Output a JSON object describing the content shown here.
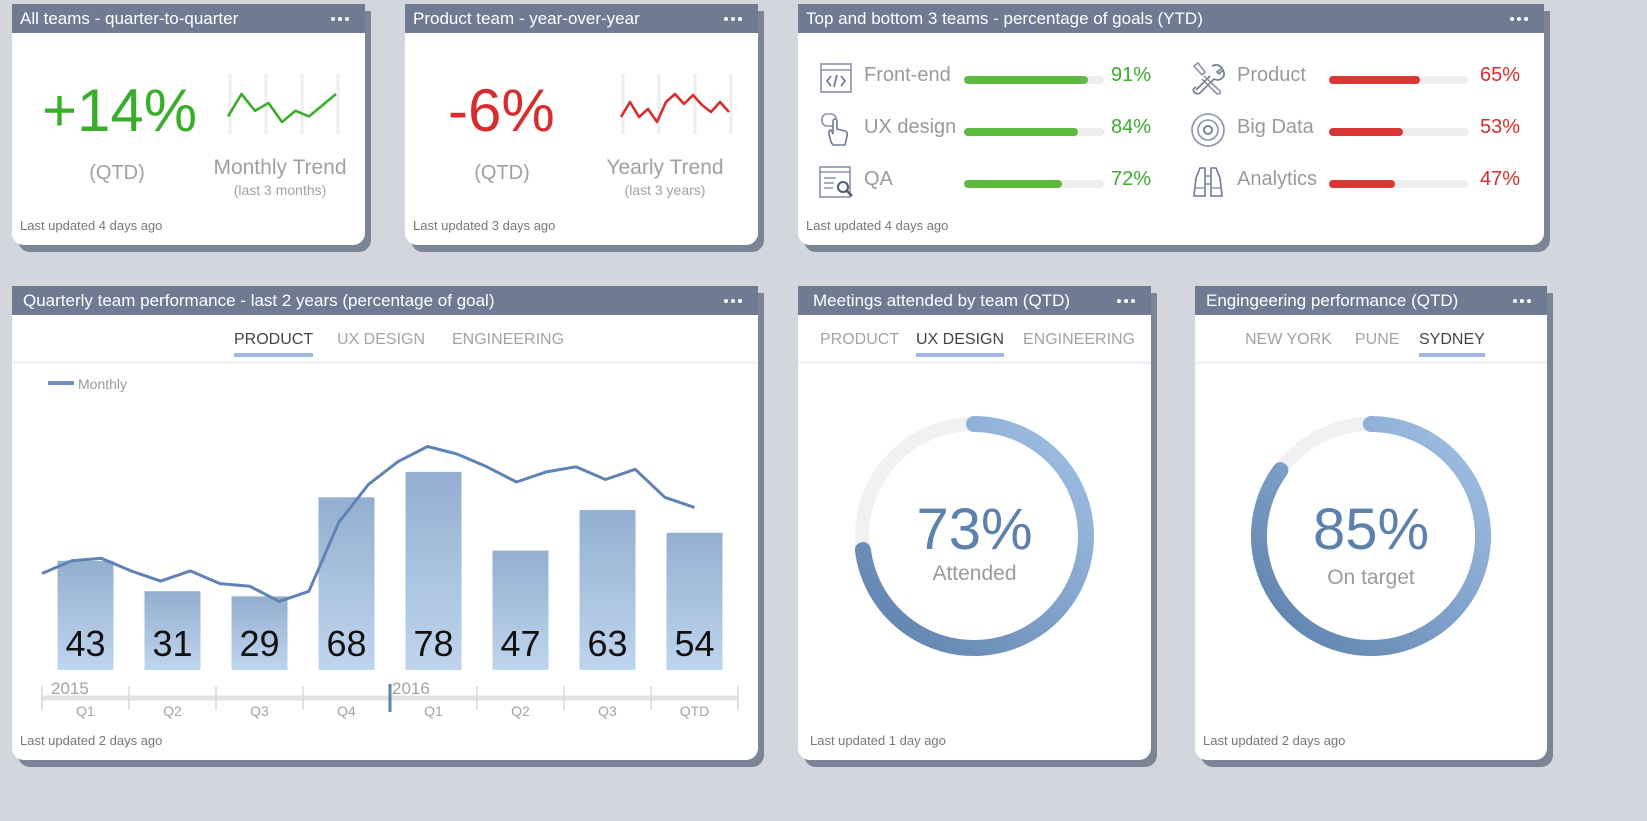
{
  "colors": {
    "header_bg": "#6e7b93",
    "green": "#3aad2b",
    "red": "#d62d2d",
    "blue": "#5f8abf",
    "bar": "#a8c0dc"
  },
  "cards": {
    "all_teams": {
      "title": "All teams - quarter-to-quarter",
      "value": "+14%",
      "period": "(QTD)",
      "trend_label": "Monthly Trend",
      "trend_sub": "(last 3 months)",
      "updated": "Last updated 4 days ago",
      "spark": [
        3,
        5,
        3.5,
        4.2,
        2.5,
        3.5,
        3,
        4,
        5
      ]
    },
    "product_team": {
      "title": "Product team - year-over-year",
      "value": "-6%",
      "period": "(QTD)",
      "trend_label": "Yearly Trend",
      "trend_sub": "(last 3 years)",
      "updated": "Last updated 3 days ago",
      "spark": [
        3,
        4.5,
        3,
        3.8,
        2.5,
        4.5,
        5.3,
        4.3,
        5.2,
        4.2,
        3.5,
        4.5,
        3.5
      ]
    },
    "top_bottom": {
      "title": "Top and bottom 3 teams - percentage of goals (YTD)",
      "updated": "Last updated 4 days ago",
      "top": [
        {
          "label": "Front-end",
          "value": 91,
          "display": "91%",
          "icon": "code-icon"
        },
        {
          "label": "UX design",
          "value": 84,
          "display": "84%",
          "icon": "touch-icon"
        },
        {
          "label": "QA",
          "value": 72,
          "display": "72%",
          "icon": "search-doc-icon"
        }
      ],
      "bottom": [
        {
          "label": "Product",
          "value": 65,
          "display": "65%",
          "icon": "tools-icon"
        },
        {
          "label": "Big Data",
          "value": 53,
          "display": "53%",
          "icon": "target-icon"
        },
        {
          "label": "Analytics",
          "value": 47,
          "display": "47%",
          "icon": "binoculars-icon"
        }
      ]
    },
    "quarterly": {
      "title": "Quarterly team performance - last 2 years (percentage of goal)",
      "tabs": [
        "PRODUCT",
        "UX DESIGN",
        "ENGINEERING"
      ],
      "active_tab": 0,
      "updated": "Last updated 2 days ago"
    },
    "meetings": {
      "title": "Meetings attended by team (QTD)",
      "tabs": [
        "PRODUCT",
        "UX DESIGN",
        "ENGINEERING"
      ],
      "active_tab": 1,
      "value": "73%",
      "percent": 73,
      "caption": "Attended",
      "updated": "Last updated 1 day ago"
    },
    "engineering": {
      "title": "Engingeering performance (QTD)",
      "tabs": [
        "NEW YORK",
        "PUNE",
        "SYDNEY"
      ],
      "active_tab": 2,
      "value": "85%",
      "percent": 85,
      "caption": "On target",
      "updated": "Last updated 2 days ago"
    }
  },
  "chart_data": {
    "type": "bar",
    "title": "Quarterly team performance - last 2 years (percentage of goal)",
    "categories": [
      "Q1",
      "Q2",
      "Q3",
      "Q4",
      "Q1",
      "Q2",
      "Q3",
      "QTD"
    ],
    "years": [
      "2015",
      "2016"
    ],
    "values": [
      43,
      31,
      29,
      68,
      78,
      47,
      63,
      54
    ],
    "ylim": [
      0,
      100
    ],
    "legend": "Monthly",
    "legend_position": "top-left",
    "line_series": {
      "name": "Monthly",
      "values": [
        38,
        43,
        44,
        39,
        35,
        39,
        34,
        33,
        27,
        31,
        58,
        73,
        82,
        88,
        85,
        80,
        74,
        78,
        80,
        75,
        79,
        68,
        64
      ]
    }
  }
}
